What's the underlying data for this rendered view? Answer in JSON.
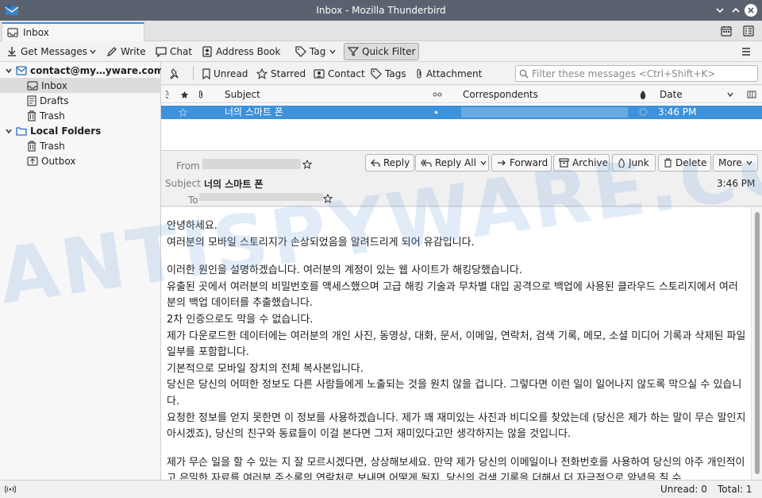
{
  "window": {
    "title": "Inbox - Mozilla Thunderbird"
  },
  "tab": {
    "label": "Inbox"
  },
  "toolbar": {
    "get_messages": "Get Messages",
    "write": "Write",
    "chat": "Chat",
    "address_book": "Address Book",
    "tag": "Tag",
    "quick_filter": "Quick Filter"
  },
  "folders": {
    "account": "contact@my…yware.com",
    "inbox": "Inbox",
    "drafts": "Drafts",
    "trash": "Trash",
    "local_folders": "Local Folders",
    "local_trash": "Trash",
    "outbox": "Outbox"
  },
  "quickfilter": {
    "unread": "Unread",
    "starred": "Starred",
    "contact": "Contact",
    "tags": "Tags",
    "attachment": "Attachment",
    "placeholder": "Filter these messages <Ctrl+Shift+K>"
  },
  "columns": {
    "subject": "Subject",
    "correspondents": "Correspondents",
    "date": "Date"
  },
  "messages": [
    {
      "subject": "너의 스마트 폰",
      "date": "3:46 PM"
    }
  ],
  "header": {
    "from_label": "From",
    "subject_label": "Subject",
    "subject": "너의 스마트 폰",
    "to_label": "To",
    "time": "3:46 PM",
    "reply": "Reply",
    "reply_all": "Reply All",
    "forward": "Forward",
    "archive": "Archive",
    "junk": "Junk",
    "delete": "Delete",
    "more": "More"
  },
  "body": {
    "paragraphs": [
      [
        "안녕하세요.",
        "여러분의 모바일 스토리지가 손상되었음을 알려드리게 되어 유감입니다."
      ],
      [
        "이러한 원인을 설명하겠습니다. 여러분의 계정이 있는 웹 사이트가 해킹당했습니다.",
        "유출된 곳에서 여러분의 비밀번호를 액세스했으며 고급 해킹 기술과 무차별 대입 공격으로 백업에 사용된 클라우드 스토리지에서 여러분의 백업 데이터를 추출했습니다.",
        "2차 인증으로도 막을 수 없습니다.",
        "제가 다운로드한 데이터에는 여러분의 개인 사진, 동영상, 대화, 문서, 이메일, 연락처, 검색 기록, 메모, 소셜 미디어 기록과 삭제된 파일 일부를 포함합니다.",
        "기본적으로 모바일 장치의 전체 복사본입니다.",
        "당신은 당신의 어떠한 정보도 다른 사람들에게 노출되는 것을 원치 않을 겁니다. 그렇다면 이런 일이 일어나지 않도록 막으실 수 있습니다.",
        "요청한 정보를 얻지 못한면 이 정보를 사용하겠습니다. 제가 꽤 재미있는 사진과 비디오를 찾았는데 (당신은 제가 하는 말이 무슨 말인지 아시겠죠), 당신의 친구와 동료들이 이걸 본다면 그저 재미있다고만 생각하지는 않을 것입니다."
      ],
      [
        "제가 무슨 일을 할 수 있는 지 잘 모르시겠다면, 상상해보세요. 만약 제가 당신의 이메일이나 전화번호를 사용하여 당신의 아주 개인적이고 은밀한 자료를 여러분 주소록의 연락처로 보내면 어떻게 될지, 당신의 검색 기록을 더해서 더 자극적으로 암념을 칠 수"
      ]
    ]
  },
  "watermark": "MYANTISPYWARE.COM",
  "status": {
    "unread": "Unread: 0",
    "total": "Total: 1"
  }
}
